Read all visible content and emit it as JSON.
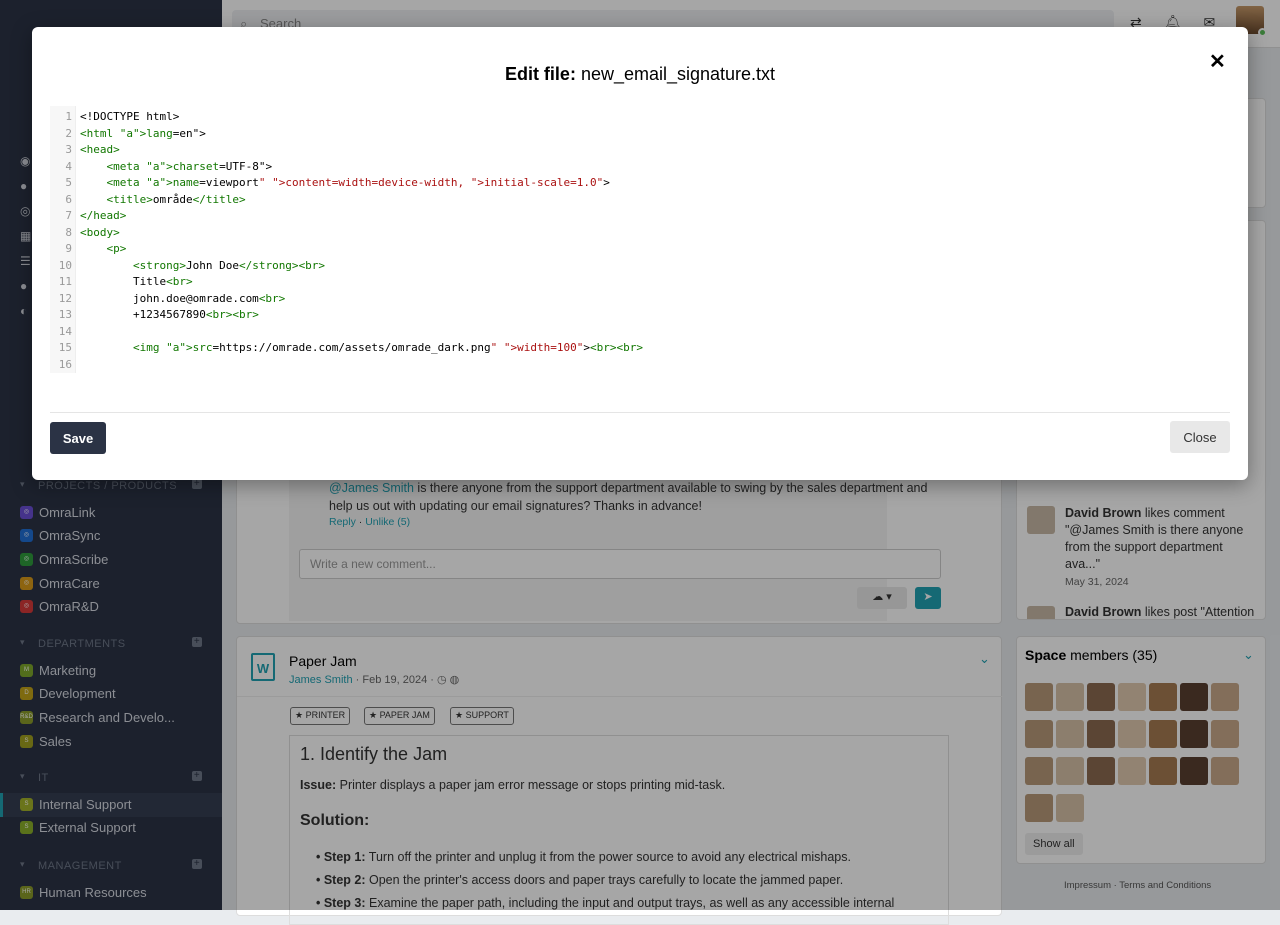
{
  "topbar": {
    "search_placeholder": "Search"
  },
  "sidebar": {
    "sections": [
      {
        "title": "PROJECTS / PRODUCTS",
        "items": [
          {
            "label": "OmraLink",
            "color": "#6a4fd6"
          },
          {
            "label": "OmraSync",
            "color": "#1f6fd6"
          },
          {
            "label": "OmraScribe",
            "color": "#2e9b3d"
          },
          {
            "label": "OmraCare",
            "color": "#d99a1a"
          },
          {
            "label": "OmraR&D",
            "color": "#d63a3a"
          }
        ]
      },
      {
        "title": "DEPARTMENTS",
        "items": [
          {
            "label": "Marketing",
            "color": "#7fa82c",
            "badge": "M"
          },
          {
            "label": "Development",
            "color": "#c2a417",
            "badge": "D"
          },
          {
            "label": "Research and Develo...",
            "color": "#8a9b2a",
            "badge": "R&D"
          },
          {
            "label": "Sales",
            "color": "#a0a020",
            "badge": "S"
          }
        ]
      },
      {
        "title": "IT",
        "items": [
          {
            "label": "Internal Support",
            "color": "#a4b22a",
            "badge": "S"
          },
          {
            "label": "External Support",
            "color": "#8ab02a",
            "badge": "S"
          }
        ]
      },
      {
        "title": "MANAGEMENT",
        "items": [
          {
            "label": "Human Resources",
            "color": "#8a9b2a",
            "badge": "HR"
          }
        ]
      }
    ]
  },
  "modal": {
    "title_bold": "Edit file:",
    "filename": "new_email_signature.txt",
    "save_label": "Save",
    "close_label": "Close",
    "code_lines": [
      "<!DOCTYPE html>",
      "<html lang=\"en\">",
      "<head>",
      "    <meta charset=\"UTF-8\">",
      "    <meta name=\"viewport\" content=\"width=device-width, initial-scale=1.0\">",
      "    <title>område</title>",
      "</head>",
      "<body>",
      "    <p>",
      "        <strong>John Doe</strong><br>",
      "        Title<br>",
      "        john.doe@omrade.com<br>",
      "        +1234567890<br><br>",
      "",
      "        <img src=\"https://omrade.com/assets/omrade_dark.png\" width=\"100\"><br><br>",
      ""
    ]
  },
  "comment": {
    "mention": "@James Smith",
    "text": " is there anyone from the support department available to swing by the sales department and help us out with updating our email signatures? Thanks in advance!",
    "reply": "Reply",
    "unlike": "Unlike (5)",
    "new_comment_placeholder": "Write a new comment..."
  },
  "post": {
    "title": "Paper Jam",
    "author": "James Smith",
    "date": "· Feb 19, 2024 ·",
    "tags": [
      "PRINTER",
      "PAPER JAM",
      "SUPPORT"
    ],
    "heading": "1. Identify the Jam",
    "issue_label": "Issue:",
    "issue_text": " Printer displays a paper jam error message or stops printing mid-task.",
    "solution": "Solution:",
    "steps": [
      {
        "label": "Step 1:",
        "text": " Turn off the printer and unplug it from the power source to avoid any electrical mishaps."
      },
      {
        "label": "Step 2:",
        "text": " Open the printer's access doors and paper trays carefully to locate the jammed paper."
      },
      {
        "label": "Step 3:",
        "text": " Examine the paper path, including the input and output trays, as well as any accessible internal"
      }
    ]
  },
  "activity": {
    "name": "David Brown",
    "action": " likes comment",
    "quote": "\"@James Smith is there anyone from the support department ava...\"",
    "date": "May 31, 2024",
    "next_name": "David Brown",
    "next_action": " likes post \"Attention"
  },
  "members": {
    "title_bold": "Space",
    "title_rest": " members (35)",
    "show_all": "Show all",
    "count": 23
  },
  "footer": {
    "impressum": "Impressum",
    "terms": "Terms and Conditions"
  }
}
